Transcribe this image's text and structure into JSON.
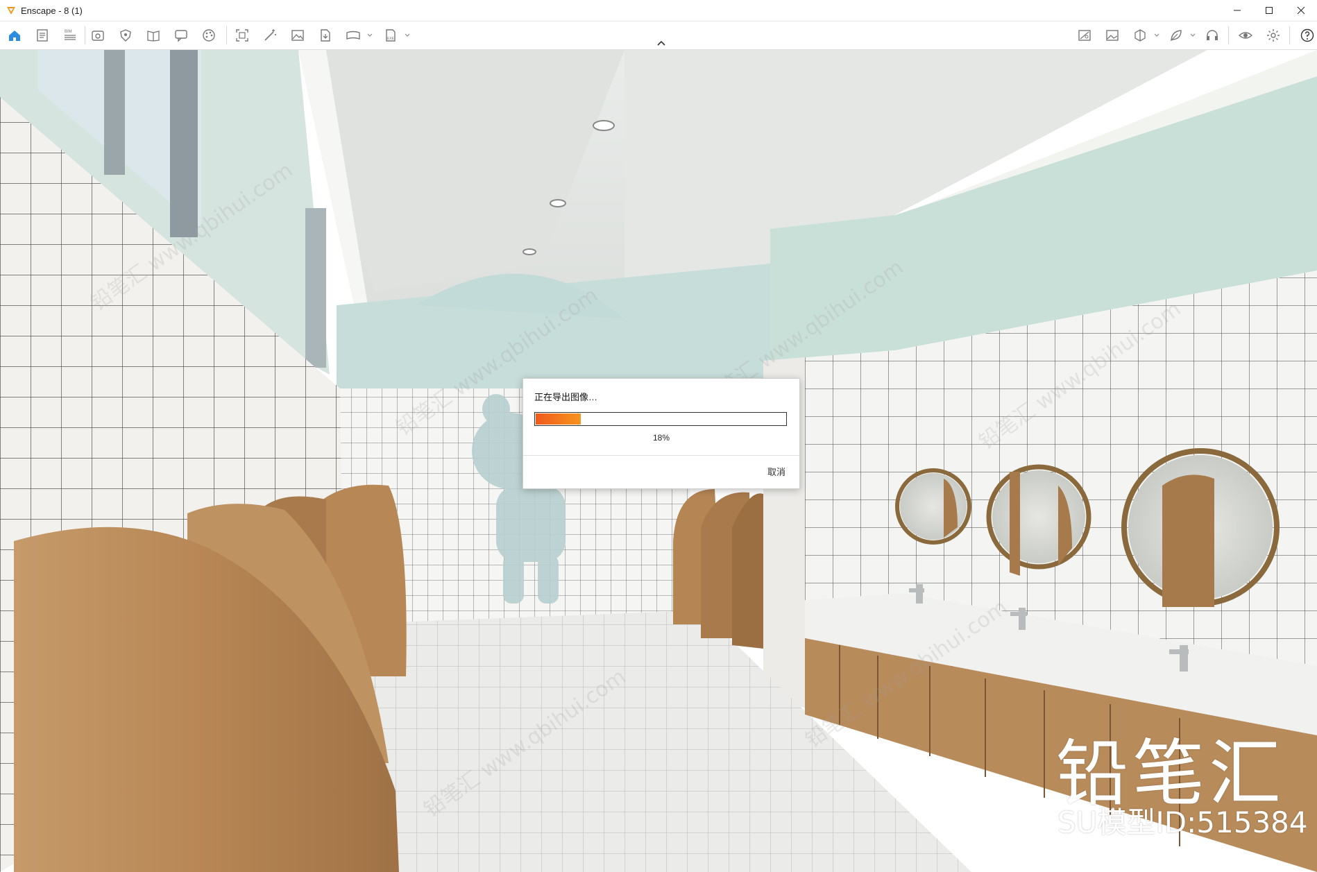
{
  "window": {
    "title": "Enscape - 8 (1)",
    "controls": [
      "minimize",
      "maximize",
      "close"
    ]
  },
  "toolbar": {
    "left_icons": [
      "home-icon",
      "file-icon",
      "bim-icon",
      "view-icon",
      "shield-icon",
      "book-icon",
      "chat-icon",
      "palette-icon",
      "capture-icon",
      "magic-icon",
      "image-icon",
      "export-icon",
      "panorama-icon",
      "exe-icon"
    ],
    "right_icons": [
      "map-icon",
      "gallery-icon",
      "cube-icon",
      "leaf-icon",
      "headset-icon",
      "eye-icon",
      "settings-icon",
      "help-icon"
    ],
    "bim_label": "BIM",
    "exe_label": "EXE"
  },
  "dialog": {
    "title": "正在导出图像…",
    "progress": 0.18,
    "progress_label": "18%",
    "cancel_label": "取消",
    "accent_start": "#f05a1d",
    "accent_end": "#f7941d"
  },
  "watermark": {
    "brand": "铅笔汇",
    "model_id": "SU模型ID:515384",
    "diagonal": "铅笔汇 www.qbihui.com"
  }
}
